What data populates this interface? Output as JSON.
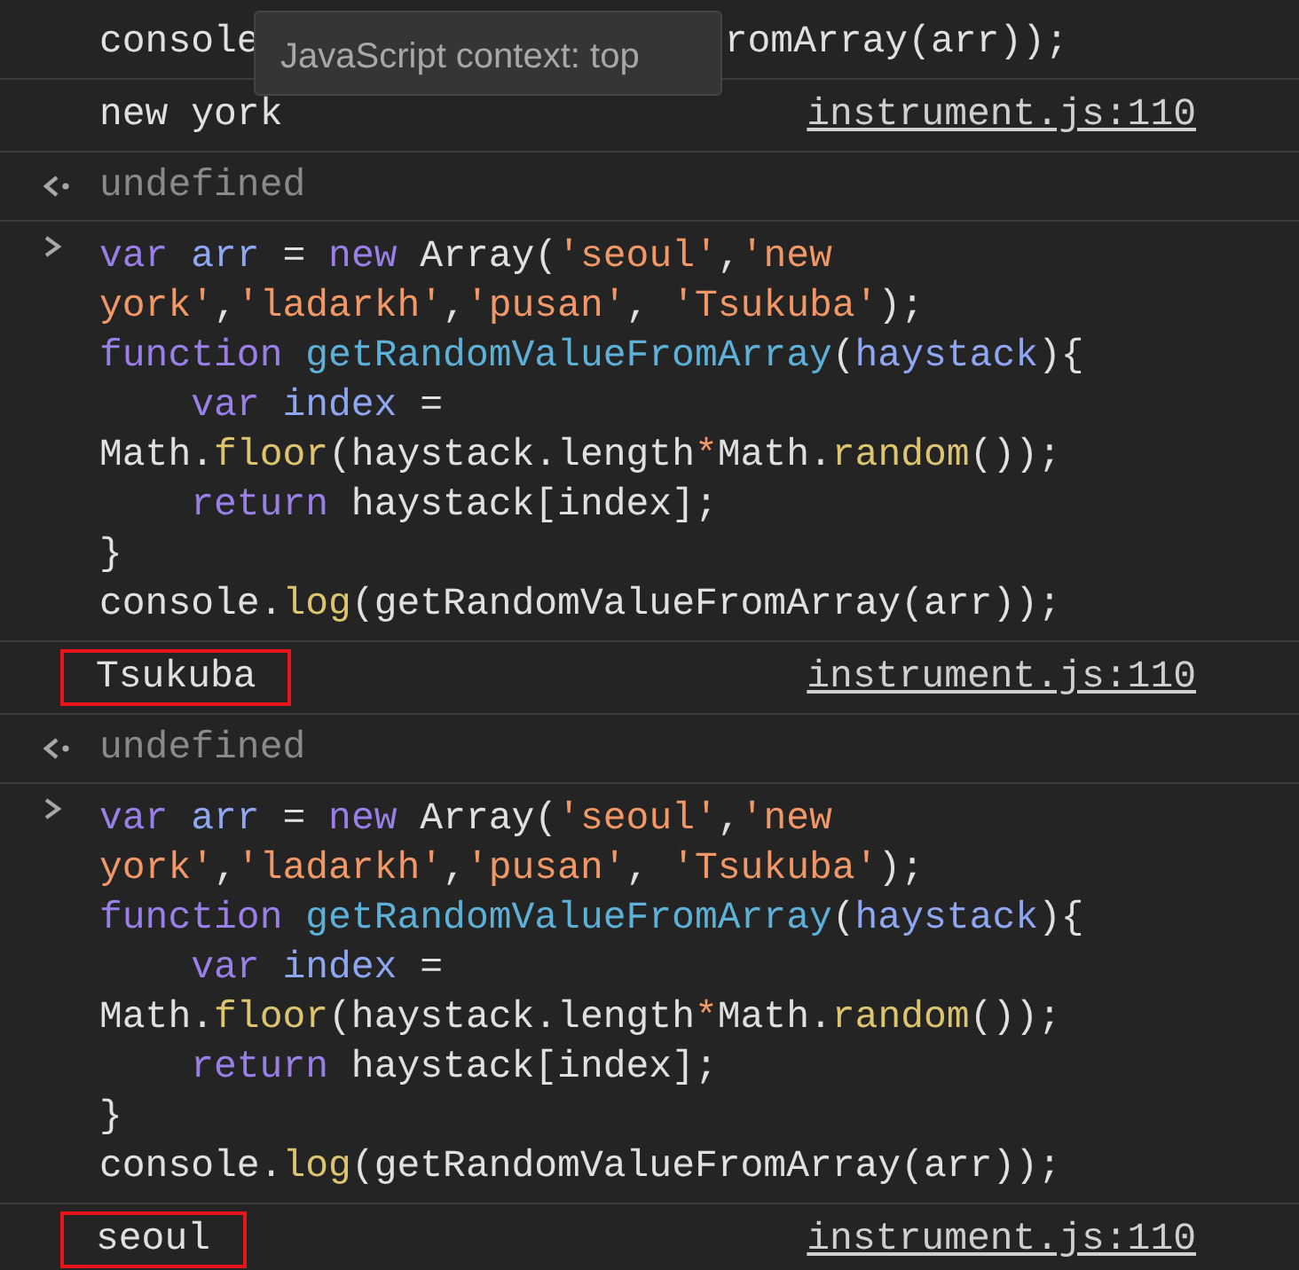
{
  "tooltip": "JavaScript context: top",
  "entries": [
    {
      "kind": "partial",
      "parts": [
        "console",
        "romArray(arr));"
      ]
    },
    {
      "kind": "log",
      "text": "new york",
      "source": "instrument.js:110",
      "boxed": false
    },
    {
      "kind": "result",
      "text": "undefined"
    },
    {
      "kind": "code",
      "prompt": true,
      "lines": [
        {
          "indent": false,
          "tokens": [
            {
              "kind": "keyword",
              "text": "var "
            },
            {
              "kind": "name",
              "text": "arr"
            },
            {
              "kind": "plain",
              "text": " = "
            },
            {
              "kind": "keyword",
              "text": "new"
            },
            {
              "kind": "plain",
              "text": " Array("
            },
            {
              "kind": "string",
              "text": "'seoul'"
            },
            {
              "kind": "plain",
              "text": ","
            },
            {
              "kind": "string",
              "text": "'new"
            }
          ]
        },
        {
          "indent": false,
          "tokens": [
            {
              "kind": "string",
              "text": "york'"
            },
            {
              "kind": "plain",
              "text": ","
            },
            {
              "kind": "string",
              "text": "'ladarkh'"
            },
            {
              "kind": "plain",
              "text": ","
            },
            {
              "kind": "string",
              "text": "'pusan'"
            },
            {
              "kind": "plain",
              "text": ", "
            },
            {
              "kind": "string",
              "text": "'Tsukuba'"
            },
            {
              "kind": "plain",
              "text": ");"
            }
          ]
        },
        {
          "indent": false,
          "tokens": [
            {
              "kind": "keyword",
              "text": "function "
            },
            {
              "kind": "function",
              "text": "getRandomValueFromArray"
            },
            {
              "kind": "plain",
              "text": "("
            },
            {
              "kind": "name",
              "text": "haystack"
            },
            {
              "kind": "plain",
              "text": "){"
            }
          ]
        },
        {
          "indent": true,
          "tokens": [
            {
              "kind": "keyword",
              "text": "var "
            },
            {
              "kind": "name",
              "text": "index"
            },
            {
              "kind": "plain",
              "text": " ="
            }
          ]
        },
        {
          "indent": false,
          "tokens": [
            {
              "kind": "plain",
              "text": "Math."
            },
            {
              "kind": "method",
              "text": "floor"
            },
            {
              "kind": "plain",
              "text": "(haystack.length"
            },
            {
              "kind": "operator",
              "text": "*"
            },
            {
              "kind": "plain",
              "text": "Math."
            },
            {
              "kind": "method",
              "text": "random"
            },
            {
              "kind": "plain",
              "text": "());"
            }
          ]
        },
        {
          "indent": true,
          "tokens": [
            {
              "kind": "keyword",
              "text": "return"
            },
            {
              "kind": "plain",
              "text": " haystack[index];"
            }
          ]
        },
        {
          "indent": false,
          "tokens": [
            {
              "kind": "plain",
              "text": "}"
            }
          ]
        },
        {
          "indent": false,
          "tokens": [
            {
              "kind": "plain",
              "text": "console."
            },
            {
              "kind": "method",
              "text": "log"
            },
            {
              "kind": "plain",
              "text": "(getRandomValueFromArray(arr));"
            }
          ]
        }
      ]
    },
    {
      "kind": "log",
      "text": "Tsukuba",
      "source": "instrument.js:110",
      "boxed": true
    },
    {
      "kind": "result",
      "text": "undefined"
    },
    {
      "kind": "code",
      "prompt": true,
      "lines": [
        {
          "indent": false,
          "tokens": [
            {
              "kind": "keyword",
              "text": "var "
            },
            {
              "kind": "name",
              "text": "arr"
            },
            {
              "kind": "plain",
              "text": " = "
            },
            {
              "kind": "keyword",
              "text": "new"
            },
            {
              "kind": "plain",
              "text": " Array("
            },
            {
              "kind": "string",
              "text": "'seoul'"
            },
            {
              "kind": "plain",
              "text": ","
            },
            {
              "kind": "string",
              "text": "'new"
            }
          ]
        },
        {
          "indent": false,
          "tokens": [
            {
              "kind": "string",
              "text": "york'"
            },
            {
              "kind": "plain",
              "text": ","
            },
            {
              "kind": "string",
              "text": "'ladarkh'"
            },
            {
              "kind": "plain",
              "text": ","
            },
            {
              "kind": "string",
              "text": "'pusan'"
            },
            {
              "kind": "plain",
              "text": ", "
            },
            {
              "kind": "string",
              "text": "'Tsukuba'"
            },
            {
              "kind": "plain",
              "text": ");"
            }
          ]
        },
        {
          "indent": false,
          "tokens": [
            {
              "kind": "keyword",
              "text": "function "
            },
            {
              "kind": "function",
              "text": "getRandomValueFromArray"
            },
            {
              "kind": "plain",
              "text": "("
            },
            {
              "kind": "name",
              "text": "haystack"
            },
            {
              "kind": "plain",
              "text": "){"
            }
          ]
        },
        {
          "indent": true,
          "tokens": [
            {
              "kind": "keyword",
              "text": "var "
            },
            {
              "kind": "name",
              "text": "index"
            },
            {
              "kind": "plain",
              "text": " ="
            }
          ]
        },
        {
          "indent": false,
          "tokens": [
            {
              "kind": "plain",
              "text": "Math."
            },
            {
              "kind": "method",
              "text": "floor"
            },
            {
              "kind": "plain",
              "text": "(haystack.length"
            },
            {
              "kind": "operator",
              "text": "*"
            },
            {
              "kind": "plain",
              "text": "Math."
            },
            {
              "kind": "method",
              "text": "random"
            },
            {
              "kind": "plain",
              "text": "());"
            }
          ]
        },
        {
          "indent": true,
          "tokens": [
            {
              "kind": "keyword",
              "text": "return"
            },
            {
              "kind": "plain",
              "text": " haystack[index];"
            }
          ]
        },
        {
          "indent": false,
          "tokens": [
            {
              "kind": "plain",
              "text": "}"
            }
          ]
        },
        {
          "indent": false,
          "tokens": [
            {
              "kind": "plain",
              "text": "console."
            },
            {
              "kind": "method",
              "text": "log"
            },
            {
              "kind": "plain",
              "text": "(getRandomValueFromArray(arr));"
            }
          ]
        }
      ]
    },
    {
      "kind": "log",
      "text": "seoul",
      "source": "instrument.js:110",
      "boxed": true
    }
  ]
}
